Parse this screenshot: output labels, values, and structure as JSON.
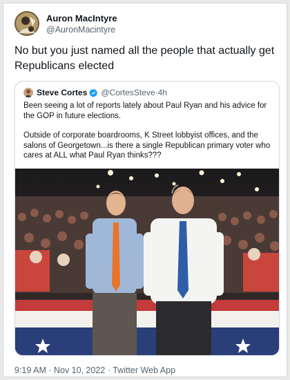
{
  "author": {
    "display_name": "Auron MacIntyre",
    "handle": "@AuronMacintyre"
  },
  "tweet": {
    "text": "No but you just named all the people that actually get Republicans elected",
    "timestamp": "9:19 AM · Nov 10, 2022",
    "separator": " · ",
    "client": "Twitter Web App"
  },
  "quoted": {
    "display_name": "Steve Cortes",
    "handle": "@CortesSteve",
    "separator": " · ",
    "age": "4h",
    "paragraph_1": "Been seeing a lot of reports lately about Paul Ryan and his advice for the GOP in future elections.",
    "paragraph_2": "Outside of corporate boardrooms, K Street lobbyist offices, and the salons of Georgetown...is there a single Republican primary voter who cares at ALL what Paul Ryan thinks???"
  },
  "colors": {
    "verified": "#1d9bf0",
    "muted_text": "#536471",
    "border": "#cfd9de"
  }
}
